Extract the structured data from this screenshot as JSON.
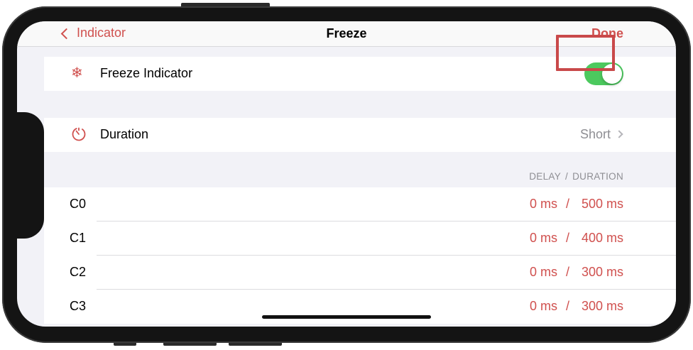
{
  "nav": {
    "back_label": "Indicator",
    "title": "Freeze",
    "done_label": "Done"
  },
  "freeze": {
    "label": "Freeze Indicator",
    "enabled": true,
    "icon": "snowflake-icon"
  },
  "duration": {
    "label": "Duration",
    "value": "Short",
    "icon": "timer-icon"
  },
  "section": {
    "delay_header": "DELAY",
    "separator": "/",
    "duration_header": "DURATION"
  },
  "channels": [
    {
      "name": "C0",
      "delay": "0 ms",
      "slash": "/",
      "duration": "500 ms"
    },
    {
      "name": "C1",
      "delay": "0 ms",
      "slash": "/",
      "duration": "400 ms"
    },
    {
      "name": "C2",
      "delay": "0 ms",
      "slash": "/",
      "duration": "300 ms"
    },
    {
      "name": "C3",
      "delay": "0 ms",
      "slash": "/",
      "duration": "300 ms"
    }
  ],
  "colors": {
    "accent": "#d0504e",
    "toggle_on": "#4cc95e",
    "highlight": "#c9494a"
  }
}
